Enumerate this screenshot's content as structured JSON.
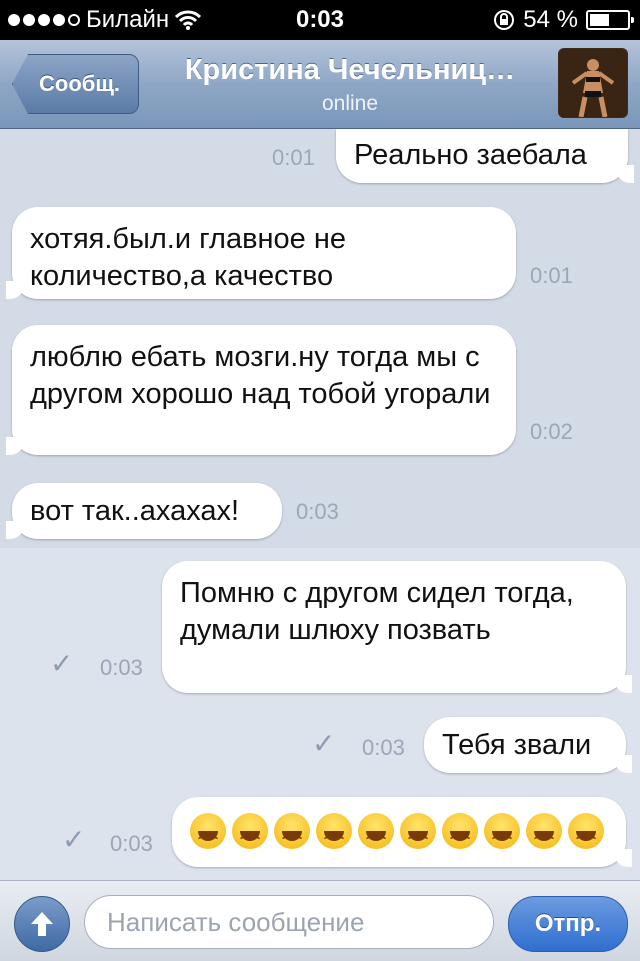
{
  "status_bar": {
    "carrier": "Билайн",
    "time": "0:03",
    "battery": "54 %",
    "battery_level": 0.54,
    "signal_bars": 4,
    "signal_max": 5
  },
  "nav": {
    "back_label": "Сообщ.",
    "title": "Кристина Чечельниц…",
    "subtitle": "online"
  },
  "messages": [
    {
      "dir": "out",
      "text": "Реально заебала",
      "time": "0:01",
      "read": false
    },
    {
      "dir": "in",
      "text": "хотяя.был.и главное не количество,а качество",
      "time": "0:01"
    },
    {
      "dir": "in",
      "text": "люблю ебать мозги.ну тогда мы с другом хорошо над тобой угорали",
      "time": "0:02"
    },
    {
      "dir": "in",
      "text": "вот так..ахахах!",
      "time": "0:03"
    },
    {
      "dir": "out",
      "text": "Помню с другом сидел тогда, думали шлюху позвать",
      "time": "0:03",
      "read": true
    },
    {
      "dir": "out",
      "text": "Тебя звали",
      "time": "0:03",
      "read": true
    },
    {
      "dir": "out",
      "text": "😆😆😆😆😆😆😆😆😆😆",
      "time": "0:03",
      "read": true
    }
  ],
  "emoji": {
    "name": "laughing-emoji",
    "count": 10
  },
  "input": {
    "placeholder": "Написать сообщение",
    "value": "",
    "send_label": "Отпр."
  },
  "icons": {
    "attach": "arrow-up-icon",
    "read": "checkmark-icon",
    "wifi": "wifi-icon",
    "lock": "rotation-lock-icon"
  }
}
